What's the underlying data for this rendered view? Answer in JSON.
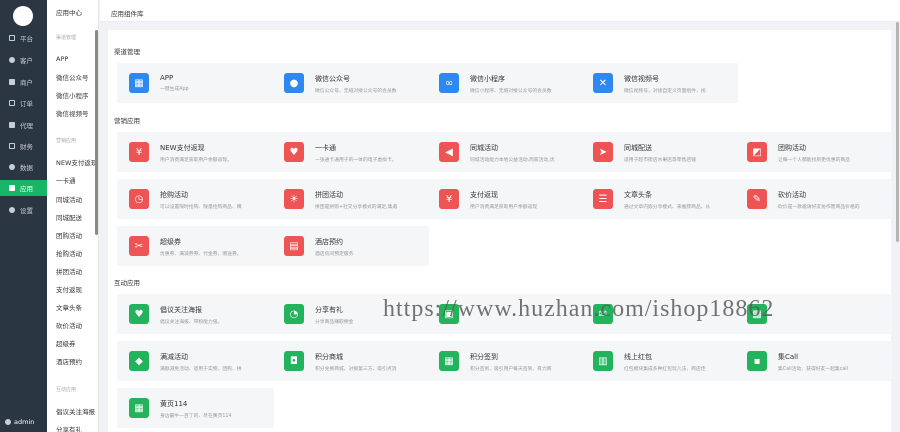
{
  "sidebar": {
    "items": [
      {
        "label": "平台",
        "icon": "monitor-icon"
      },
      {
        "label": "客户",
        "icon": "user-icon"
      },
      {
        "label": "商户",
        "icon": "store-icon"
      },
      {
        "label": "订单",
        "icon": "order-icon"
      },
      {
        "label": "代理",
        "icon": "agent-icon"
      },
      {
        "label": "财务",
        "icon": "finance-icon"
      },
      {
        "label": "数据",
        "icon": "data-icon"
      },
      {
        "label": "应用",
        "icon": "apps-icon"
      },
      {
        "label": "设置",
        "icon": "gear-icon"
      }
    ],
    "active_index": 7,
    "user": "admin",
    "active_color": "#18b566"
  },
  "subnav": {
    "title": "应用中心",
    "groups": [
      {
        "label": "渠道管理",
        "links": [
          "APP",
          "微信公众号",
          "微信小程序",
          "微信视频号"
        ]
      },
      {
        "label": "营销应用",
        "links": [
          "NEW支付返现",
          "一卡通",
          "同城活动",
          "同城配送",
          "团购活动",
          "抢购活动",
          "拼团活动",
          "支付返现",
          "文章头条",
          "砍价活动",
          "超级券",
          "酒店预约"
        ]
      },
      {
        "label": "互动应用",
        "links": [
          "倡议关注海报",
          "分享有礼"
        ]
      }
    ]
  },
  "header": {
    "title": "应用组件库"
  },
  "sections": [
    {
      "title": "渠道管理",
      "tiles": [
        {
          "name": "APP",
          "desc": "一键生成App",
          "icon": "apps-grid-icon",
          "color": "blue"
        },
        {
          "name": "微信公众号",
          "desc": "微信公众号、无缝对接公众号的会员数",
          "icon": "wechat-icon",
          "color": "blue"
        },
        {
          "name": "微信小程序",
          "desc": "微信小程序、无缝对接公众号的会员数",
          "icon": "mini-program-icon",
          "color": "blue"
        },
        {
          "name": "微信视频号",
          "desc": "微信视频号，对接自定义页面组件，视",
          "icon": "video-channel-icon",
          "color": "blue"
        }
      ]
    },
    {
      "title": "营销应用",
      "tiles": [
        {
          "name": "NEW支付返现",
          "desc": "用户消费满足获取用户余额返现。",
          "icon": "money-bag-icon",
          "color": "red"
        },
        {
          "name": "一卡通",
          "desc": "一张通卡通用于的一体的电子虚拟卡。",
          "icon": "heart-card-icon",
          "color": "red"
        },
        {
          "name": "同城活动",
          "desc": "同城活动能力本地公益活动,周家活动,优",
          "icon": "megaphone-icon",
          "color": "red"
        },
        {
          "name": "同城配送",
          "desc": "适用于超市街店水果店等零售店铺",
          "icon": "scooter-icon",
          "color": "red"
        },
        {
          "name": "团购活动",
          "desc": "让每一个人都能找到更优惠的商品",
          "icon": "group-buy-icon",
          "color": "red"
        },
        {
          "name": "抢购活动",
          "desc": "可以设置限时抢购、限量抢购商品、释",
          "icon": "clock-icon",
          "color": "red"
        },
        {
          "name": "拼团活动",
          "desc": "拼团是拼购+社交分享模式的满足,集邀",
          "icon": "bulb-icon",
          "color": "red"
        },
        {
          "name": "支付返现",
          "desc": "用户消费满足获取用户余额返现",
          "icon": "money-bag-icon",
          "color": "red"
        },
        {
          "name": "文章头条",
          "desc": "通过文章内嵌分享模式、来推荐商品、从",
          "icon": "article-icon",
          "color": "red"
        },
        {
          "name": "砍价活动",
          "desc": "砍价是一款邀请好友协作而商品价格的",
          "icon": "bargain-icon",
          "color": "red"
        },
        {
          "name": "超级券",
          "desc": "优惠券、满减券券、代金券、赠送券。",
          "icon": "coupon-icon",
          "color": "red"
        },
        {
          "name": "酒店预约",
          "desc": "酒店房间预定服务",
          "icon": "hotel-icon",
          "color": "red"
        }
      ]
    },
    {
      "title": "互动应用",
      "tiles": [
        {
          "name": "倡议关注海报",
          "desc": "倡议关注海报、带粉能力强。",
          "icon": "heart-icon",
          "color": "green"
        },
        {
          "name": "分享有礼",
          "desc": "分享商品赚取佣金",
          "icon": "share-icon",
          "color": "green"
        },
        {
          "name": "",
          "desc": "",
          "icon": "poster-icon",
          "color": "green"
        },
        {
          "name": "",
          "desc": "",
          "icon": "chat-icon",
          "color": "green"
        },
        {
          "name": "",
          "desc": "",
          "icon": "present-icon",
          "color": "green"
        },
        {
          "name": "满减活动",
          "desc": "满额减免活动、适用于实物、团购、拼",
          "icon": "tag-icon",
          "color": "green"
        },
        {
          "name": "积分商城",
          "desc": "积分兑换商城、对接第三方、吸引点消",
          "icon": "shop-bag-icon",
          "color": "green"
        },
        {
          "name": "积分签到",
          "desc": "积分签到、吸引用户每天签到、有力商",
          "icon": "calendar-icon",
          "color": "green"
        },
        {
          "name": "线上红包",
          "desc": "红包模块集成多种红包玩儿法、商店佳",
          "icon": "red-packet-icon",
          "color": "green"
        },
        {
          "name": "集Call",
          "desc": "集Call活动、获得好友一起集call",
          "icon": "gift-icon",
          "color": "green"
        },
        {
          "name": "黄页114",
          "desc": "身边最牛一百了的、尽在黄页114",
          "icon": "book-icon",
          "color": "green"
        }
      ]
    }
  ],
  "watermark": "https://www.huzhan.com/ishop18862"
}
